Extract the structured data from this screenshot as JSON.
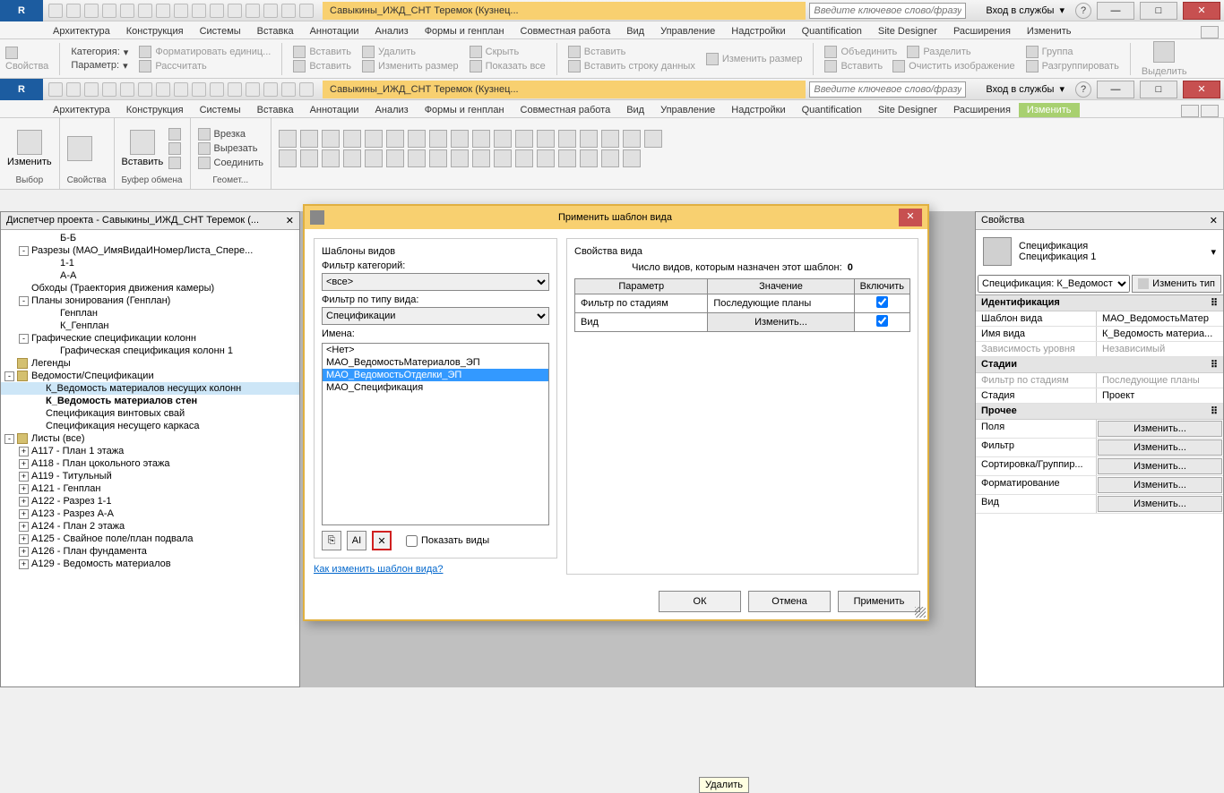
{
  "app": {
    "logo": "R"
  },
  "window1": {
    "title": "Савыкины_ИЖД_СНТ Теремок (Кузнец...",
    "search_placeholder": "Введите ключевое слово/фразу",
    "signin": "Вход в службы"
  },
  "window2": {
    "title": "Савыкины_ИЖД_СНТ Теремок (Кузнец...",
    "search_placeholder": "Введите ключевое слово/фразу",
    "signin": "Вход в службы"
  },
  "tabs": [
    "Архитектура",
    "Конструкция",
    "Системы",
    "Вставка",
    "Аннотации",
    "Анализ",
    "Формы и генплан",
    "Совместная работа",
    "Вид",
    "Управление",
    "Надстройки",
    "Quantification",
    "Site Designer",
    "Расширения",
    "Изменить"
  ],
  "ribbon1": {
    "props": "Свойства",
    "category": "Категория:",
    "parameter": "Параметр:",
    "fmt_units": "Форматировать единиц...",
    "calc": "Рассчитать",
    "insert1": "Вставить",
    "insert2": "Вставить",
    "delete": "Удалить",
    "resize": "Изменить размер",
    "hide": "Скрыть",
    "show": "Показать все",
    "insert3": "Вставить",
    "insert_row": "Вставить строку данных",
    "resize2": "Изменить размер",
    "merge": "Объединить",
    "split": "Разделить",
    "insert4": "Вставить",
    "clearimg": "Очистить изображение",
    "group": "Группа",
    "ungroup": "Разгруппировать",
    "highlight": "Выделить"
  },
  "ribbon2": {
    "modify": "Изменить",
    "select": "Выбор",
    "props": "Свойства",
    "paste": "Вставить",
    "clipboard": "Буфер обмена",
    "cut_in": "Врезка",
    "cut": "Вырезать",
    "connect": "Соединить",
    "geom": "Геомет..."
  },
  "browser": {
    "title": "Диспетчер проекта - Савыкины_ИЖД_СНТ Теремок (...",
    "nodes": [
      {
        "indent": 3,
        "label": "Б-Б"
      },
      {
        "indent": 1,
        "tw": "-",
        "label": "Разрезы (МАО_ИмяВидаИНомерЛиста_Спере..."
      },
      {
        "indent": 3,
        "label": "1-1"
      },
      {
        "indent": 3,
        "label": "А-А"
      },
      {
        "indent": 1,
        "label": "Обходы (Траектория движения камеры)"
      },
      {
        "indent": 1,
        "tw": "-",
        "label": "Планы зонирования (Генплан)"
      },
      {
        "indent": 3,
        "label": "Генплан"
      },
      {
        "indent": 3,
        "label": "К_Генплан"
      },
      {
        "indent": 1,
        "tw": "-",
        "label": "Графические спецификации колонн"
      },
      {
        "indent": 3,
        "label": "Графическая спецификация колонн 1"
      },
      {
        "indent": 0,
        "icon": true,
        "label": "Легенды"
      },
      {
        "indent": 0,
        "tw": "-",
        "icon": true,
        "label": "Ведомости/Спецификации"
      },
      {
        "indent": 2,
        "label": "К_Ведомость материалов несущих колонн",
        "sel": true
      },
      {
        "indent": 2,
        "label": "К_Ведомость материалов стен",
        "bold": true
      },
      {
        "indent": 2,
        "label": "Спецификация винтовых свай"
      },
      {
        "indent": 2,
        "label": "Спецификация несущего каркаса"
      },
      {
        "indent": 0,
        "tw": "-",
        "icon": true,
        "label": "Листы (все)"
      },
      {
        "indent": 1,
        "tw": "+",
        "label": "А117 - План 1 этажа"
      },
      {
        "indent": 1,
        "tw": "+",
        "label": "А118 - План цокольного этажа"
      },
      {
        "indent": 1,
        "tw": "+",
        "label": "А119 - Титульный"
      },
      {
        "indent": 1,
        "tw": "+",
        "label": "А121 - Генплан"
      },
      {
        "indent": 1,
        "tw": "+",
        "label": "А122 - Разрез 1-1"
      },
      {
        "indent": 1,
        "tw": "+",
        "label": "А123 - Разрез А-А"
      },
      {
        "indent": 1,
        "tw": "+",
        "label": "А124 - План 2 этажа"
      },
      {
        "indent": 1,
        "tw": "+",
        "label": "А125 - Свайное поле/план подвала"
      },
      {
        "indent": 1,
        "tw": "+",
        "label": "А126 - План фундамента"
      },
      {
        "indent": 1,
        "tw": "+",
        "label": "А129 - Ведомость материалов"
      }
    ]
  },
  "props": {
    "title": "Свойства",
    "type_name": "Спецификация",
    "type_sub": "Спецификация 1",
    "selector": "Спецификация: К_Ведомост",
    "edit_type": "Изменить тип",
    "sections": [
      {
        "name": "Идентификация",
        "rows": [
          {
            "k": "Шаблон вида",
            "v": "МАО_ВедомостьМатер"
          },
          {
            "k": "Имя вида",
            "v": "К_Ведомость материа..."
          },
          {
            "k": "Зависимость уровня",
            "v": "Независимый",
            "dis": true
          }
        ]
      },
      {
        "name": "Стадии",
        "rows": [
          {
            "k": "Фильтр по стадиям",
            "v": "Последующие планы",
            "dis": true
          },
          {
            "k": "Стадия",
            "v": "Проект"
          }
        ]
      },
      {
        "name": "Прочее",
        "rows": [
          {
            "k": "Поля",
            "v": "Изменить...",
            "btn": true
          },
          {
            "k": "Фильтр",
            "v": "Изменить...",
            "btn": true
          },
          {
            "k": "Сортировка/Группир...",
            "v": "Изменить...",
            "btn": true
          },
          {
            "k": "Форматирование",
            "v": "Изменить...",
            "btn": true
          },
          {
            "k": "Вид",
            "v": "Изменить...",
            "btn": true
          }
        ]
      }
    ]
  },
  "modal": {
    "title": "Применить шаблон вида",
    "left_group": "Шаблоны видов",
    "filter_cat": "Фильтр категорий:",
    "filter_cat_val": "<все>",
    "filter_type": "Фильтр по типу вида:",
    "filter_type_val": "Спецификации",
    "names": "Имена:",
    "list": [
      "<Нет>",
      "МАО_ВедомостьМатериалов_ЭП",
      "МАО_ВедомостьОтделки_ЭП",
      "МАО_Спецификация"
    ],
    "list_sel": 2,
    "show_views": "Показать виды",
    "delete_tooltip": "Удалить",
    "link": "Как изменить шаблон вида?",
    "right_group": "Свойства вида",
    "count_label": "Число видов, которым назначен этот шаблон:",
    "count": "0",
    "th": [
      "Параметр",
      "Значение",
      "Включить"
    ],
    "rows": [
      {
        "p": "Фильтр по стадиям",
        "v": "Последующие планы",
        "btn": false,
        "c": true
      },
      {
        "p": "Вид",
        "v": "Изменить...",
        "btn": true,
        "c": true
      }
    ],
    "ok": "ОК",
    "cancel": "Отмена",
    "apply": "Применить"
  }
}
